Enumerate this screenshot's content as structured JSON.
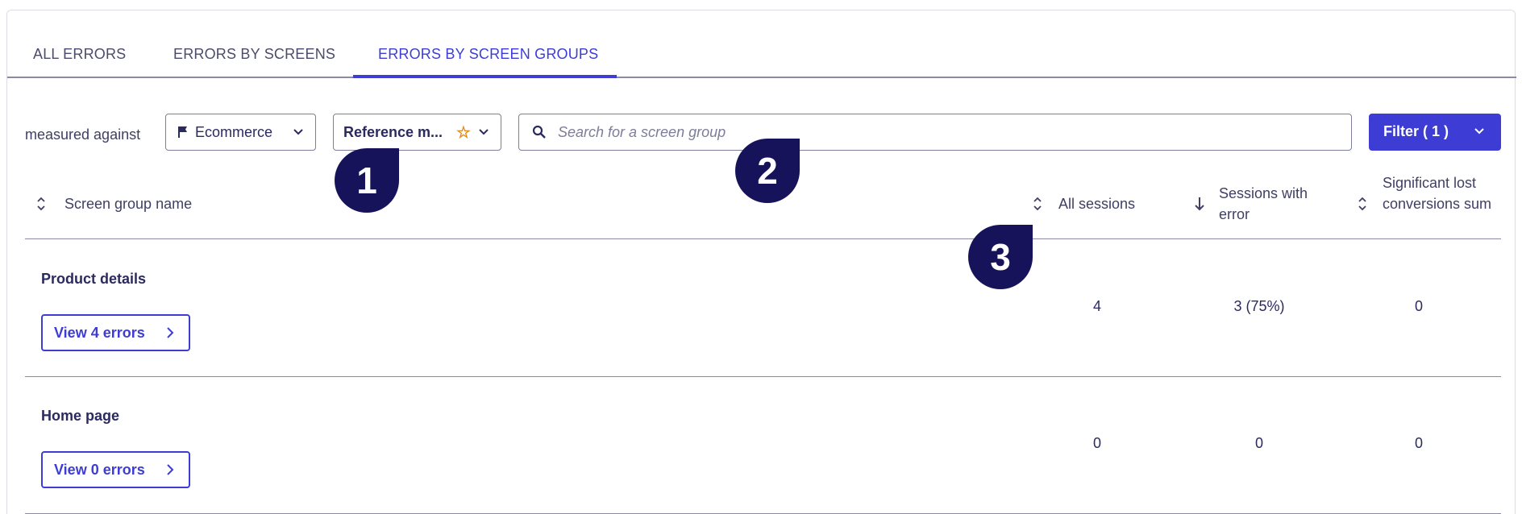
{
  "tabs": [
    {
      "label": "ALL ERRORS"
    },
    {
      "label": "ERRORS BY SCREENS"
    },
    {
      "label": "ERRORS BY SCREEN GROUPS"
    }
  ],
  "toolbar": {
    "measured_label": "measured against",
    "goal_select": "Ecommerce",
    "reference_select": "Reference m...",
    "search_placeholder": "Search for a screen group",
    "filter_label": "Filter ( 1 )"
  },
  "table": {
    "columns": [
      {
        "label": "Screen group name"
      },
      {
        "label": "All sessions"
      },
      {
        "label": "Sessions with error"
      },
      {
        "label": "Significant lost conversions sum"
      }
    ],
    "rows": [
      {
        "name": "Product details",
        "button": "View 4 errors",
        "all_sessions": "4",
        "sessions_with_error": "3 (75%)",
        "lost_conversions": "0"
      },
      {
        "name": "Home page",
        "button": "View 0 errors",
        "all_sessions": "0",
        "sessions_with_error": "0",
        "lost_conversions": "0"
      }
    ]
  },
  "markers": [
    "1",
    "2",
    "3"
  ],
  "colors": {
    "accent": "#3d3dd6",
    "marker": "#17135a",
    "text": "#2b2a5e",
    "star": "#e08a1e"
  }
}
